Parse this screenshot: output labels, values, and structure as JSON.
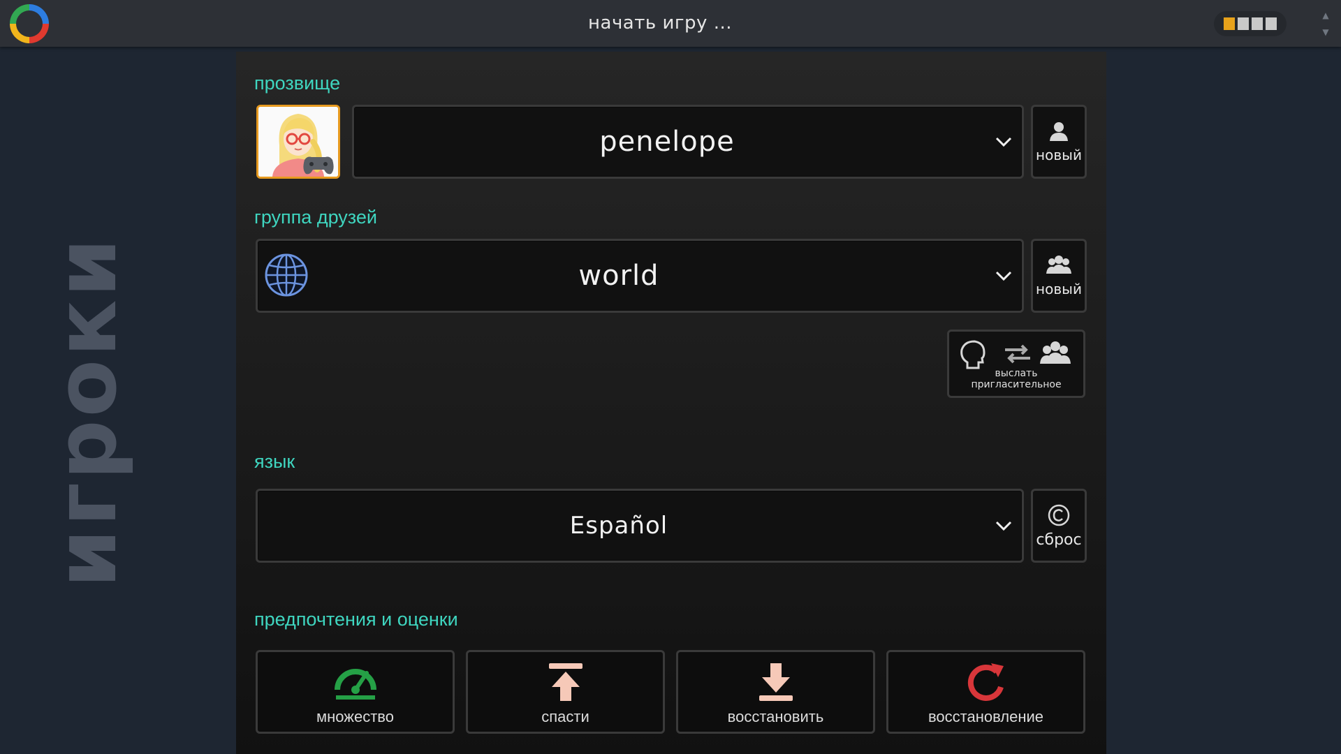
{
  "topbar": {
    "title": "начать  игру  ...",
    "view_switcher": {
      "active_index": 0,
      "count": 4,
      "accent": "#e7a21b"
    }
  },
  "side": {
    "label": "игроки"
  },
  "sections": {
    "nickname": {
      "label": "прозвище",
      "value": "penelope",
      "new_button": "новый",
      "avatar_icon": "avatar-blonde-glasses-with-gamepad"
    },
    "friends_group": {
      "label": "группа друзей",
      "value": "world",
      "new_button": "новый",
      "invite_button": "выслать пригласительное",
      "icon": "globe-icon"
    },
    "language": {
      "label": "язык",
      "value": "Español",
      "reset_button": "сброс"
    },
    "preferences": {
      "label": "предпочтения и оценки",
      "buttons": [
        {
          "label": "множество",
          "icon": "speedometer-icon",
          "color": "#25a046"
        },
        {
          "label": "спасти",
          "icon": "upload-icon",
          "color": "#f6c9b8"
        },
        {
          "label": "восстановить",
          "icon": "download-icon",
          "color": "#f6c9b8"
        },
        {
          "label": "восстановление",
          "icon": "reset-arrow-icon",
          "color": "#d8363a"
        }
      ]
    }
  },
  "colors": {
    "accent_label": "#3fd6c0",
    "avatar_border": "#e79a1f"
  }
}
